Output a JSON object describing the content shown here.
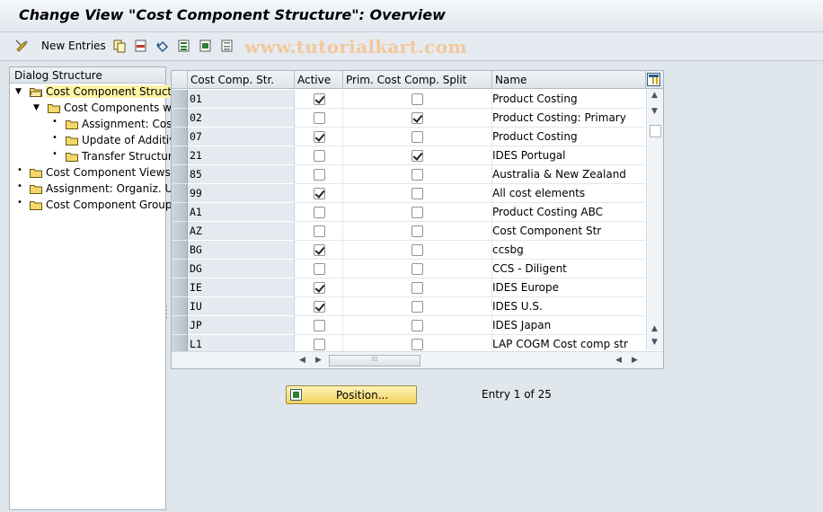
{
  "title": "Change View \"Cost Component Structure\": Overview",
  "toolbar": {
    "new_entries_label": "New Entries",
    "icons": [
      "edit-glasses-icon",
      "copy-icon",
      "delete-icon",
      "undo-icon",
      "select-all-icon",
      "select-block-icon",
      "deselect-all-icon"
    ]
  },
  "watermark": "www.tutorialkart.com",
  "dialog_structure": {
    "header": "Dialog Structure",
    "items": [
      {
        "label": "Cost Component Structu",
        "level": 0,
        "expanded": true,
        "selected": true
      },
      {
        "label": "Cost Components wi",
        "level": 1,
        "expanded": true
      },
      {
        "label": "Assignment: Cost",
        "level": 2
      },
      {
        "label": "Update of Additiv",
        "level": 2
      },
      {
        "label": "Transfer Structur",
        "level": 2
      },
      {
        "label": "Cost Component Views",
        "level": 0
      },
      {
        "label": "Assignment: Organiz. Un",
        "level": 0
      },
      {
        "label": "Cost Component Groups",
        "level": 0
      }
    ]
  },
  "table": {
    "columns": [
      "Cost Comp. Str.",
      "Active",
      "Prim. Cost Comp. Split",
      "Name"
    ],
    "rows": [
      {
        "key": "01",
        "active": true,
        "prim": false,
        "name": "Product Costing"
      },
      {
        "key": "02",
        "active": false,
        "prim": true,
        "name": "Product Costing: Primary"
      },
      {
        "key": "07",
        "active": true,
        "prim": false,
        "name": "Product Costing"
      },
      {
        "key": "21",
        "active": false,
        "prim": true,
        "name": "IDES Portugal"
      },
      {
        "key": "85",
        "active": false,
        "prim": false,
        "name": "Australia & New Zealand"
      },
      {
        "key": "99",
        "active": true,
        "prim": false,
        "name": "All cost elements"
      },
      {
        "key": "A1",
        "active": false,
        "prim": false,
        "name": "Product Costing ABC"
      },
      {
        "key": "AZ",
        "active": false,
        "prim": false,
        "name": "Cost Component Str"
      },
      {
        "key": "BG",
        "active": true,
        "prim": false,
        "name": "ccsbg"
      },
      {
        "key": "DG",
        "active": false,
        "prim": false,
        "name": "CCS - Diligent"
      },
      {
        "key": "IE",
        "active": true,
        "prim": false,
        "name": "IDES Europe"
      },
      {
        "key": "IU",
        "active": true,
        "prim": false,
        "name": "IDES U.S."
      },
      {
        "key": "JP",
        "active": false,
        "prim": false,
        "name": "IDES Japan"
      },
      {
        "key": "L1",
        "active": false,
        "prim": false,
        "name": "LAP COGM Cost comp str"
      }
    ]
  },
  "position_button_label": "Position...",
  "entry_info": "Entry 1 of 25"
}
